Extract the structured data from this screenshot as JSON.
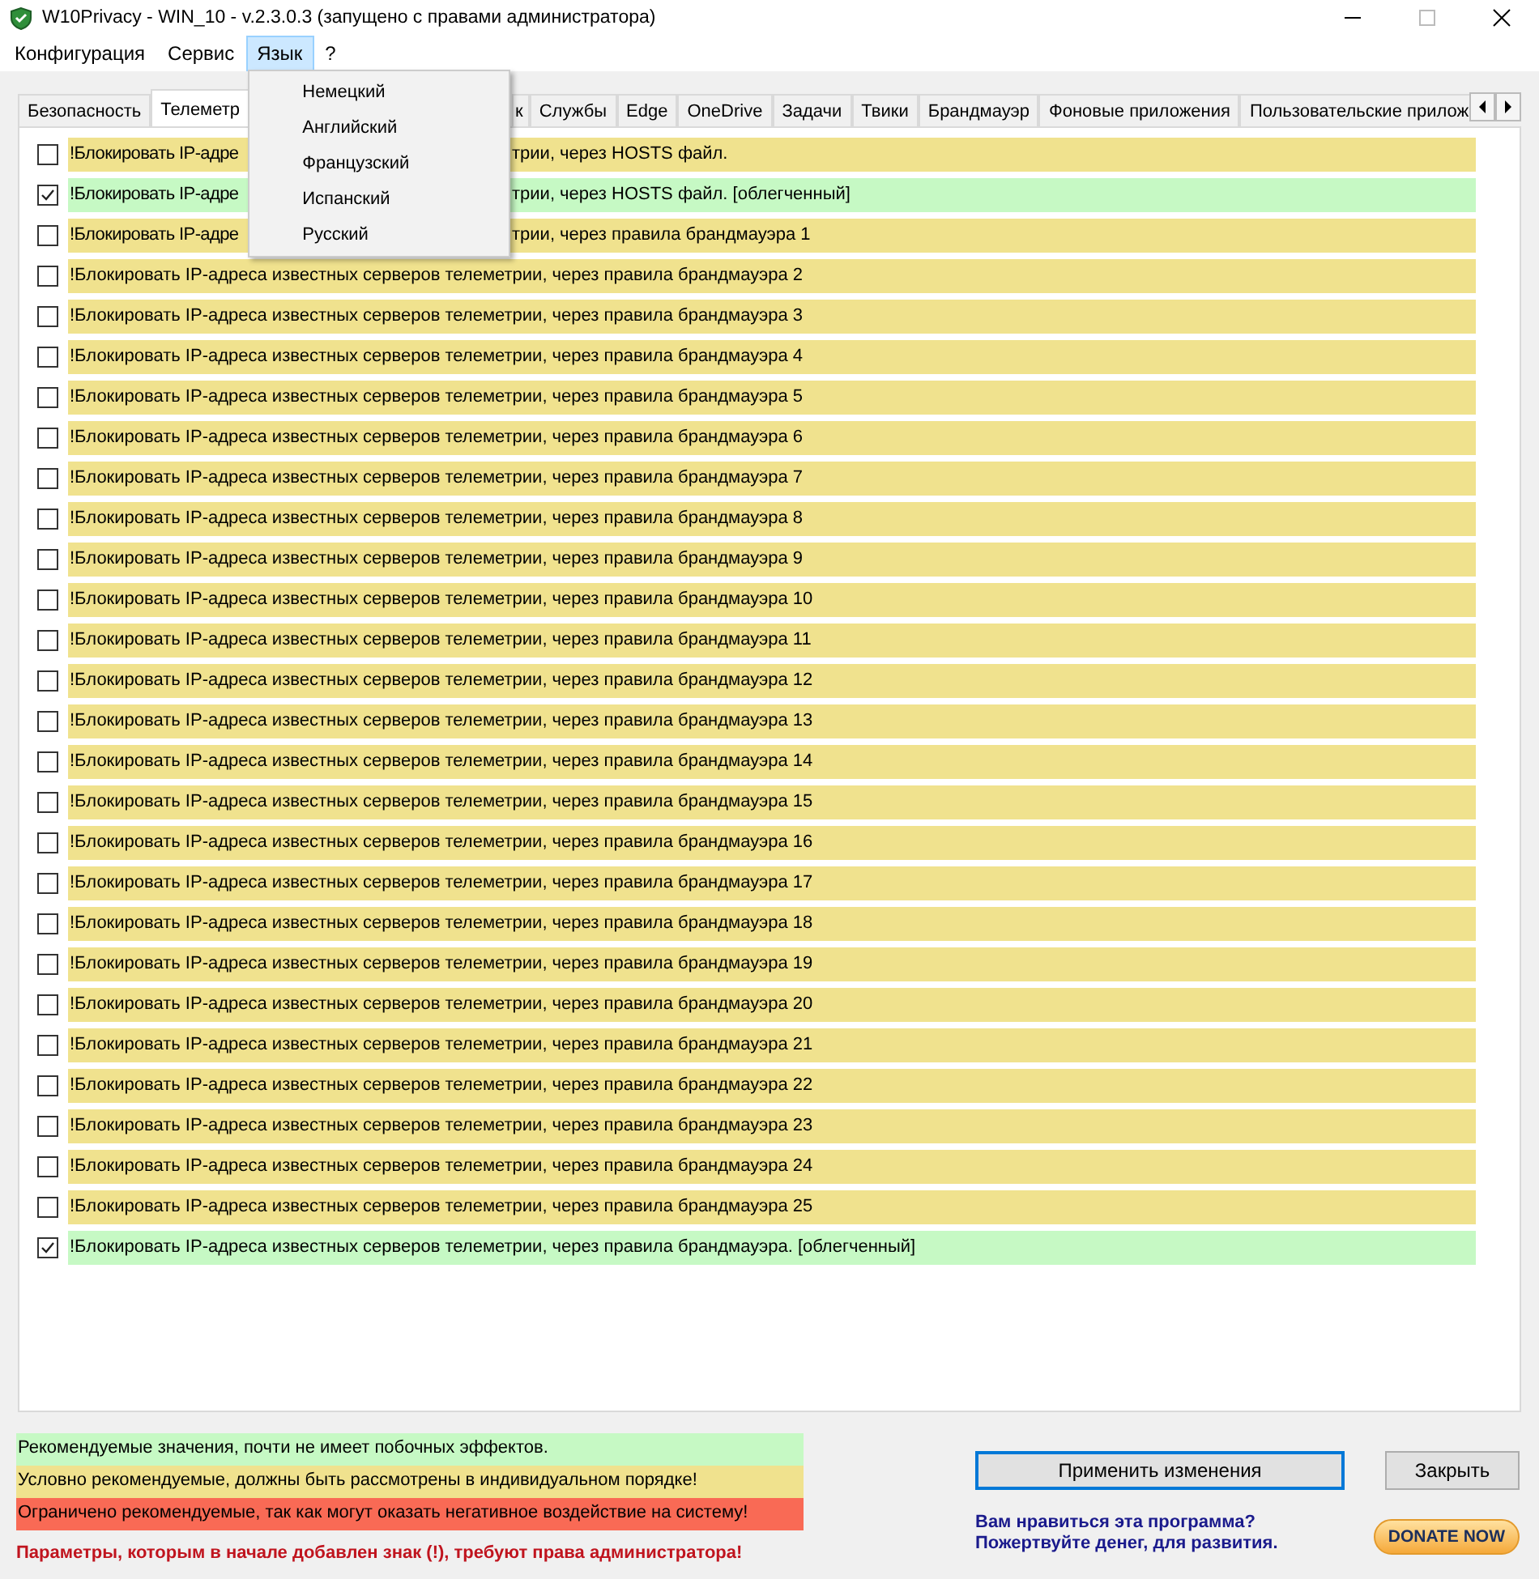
{
  "window": {
    "title": "W10Privacy - WIN_10 - v.2.3.0.3 (запущено с правами администратора)"
  },
  "menu_bar": [
    {
      "label": "Конфигурация",
      "selected": false
    },
    {
      "label": "Сервис",
      "selected": false
    },
    {
      "label": "Язык",
      "selected": true,
      "items": [
        "Немецкий",
        "Английский",
        "Французский",
        "Испанский",
        "Русский"
      ]
    },
    {
      "label": "?",
      "selected": false
    }
  ],
  "tabs": [
    {
      "label": "Безопасность",
      "selected": false
    },
    {
      "label": "Телеметр",
      "selected": true
    },
    {
      "label": "к",
      "selected": false
    },
    {
      "label": "Службы",
      "selected": false
    },
    {
      "label": "Edge",
      "selected": false
    },
    {
      "label": "OneDrive",
      "selected": false
    },
    {
      "label": "Задачи",
      "selected": false
    },
    {
      "label": "Твики",
      "selected": false
    },
    {
      "label": "Брандмауэр",
      "selected": false
    },
    {
      "label": "Фоновые приложения",
      "selected": false
    },
    {
      "label": "Пользовательские прилож",
      "selected": false
    }
  ],
  "settings": [
    {
      "label_parts": [
        "!Блокировать IP-адре",
        "трии, через HOSTS файл."
      ],
      "kind": "conditional",
      "checked": false
    },
    {
      "label_parts": [
        "!Блокировать IP-адре",
        "трии, через HOSTS файл. [облегченный]"
      ],
      "kind": "recommended",
      "checked": true
    },
    {
      "label_parts": [
        "!Блокировать IP-адре",
        "трии, через правила брандмауэра 1"
      ],
      "kind": "conditional",
      "checked": false
    },
    {
      "label": "!Блокировать IP-адреса известных серверов телеметрии, через правила брандмауэра 2",
      "kind": "conditional",
      "checked": false
    },
    {
      "label": "!Блокировать IP-адреса известных серверов телеметрии, через правила брандмауэра 3",
      "kind": "conditional",
      "checked": false
    },
    {
      "label": "!Блокировать IP-адреса известных серверов телеметрии, через правила брандмауэра 4",
      "kind": "conditional",
      "checked": false
    },
    {
      "label": "!Блокировать IP-адреса известных серверов телеметрии, через правила брандмауэра 5",
      "kind": "conditional",
      "checked": false
    },
    {
      "label": "!Блокировать IP-адреса известных серверов телеметрии, через правила брандмауэра 6",
      "kind": "conditional",
      "checked": false
    },
    {
      "label": "!Блокировать IP-адреса известных серверов телеметрии, через правила брандмауэра 7",
      "kind": "conditional",
      "checked": false
    },
    {
      "label": "!Блокировать IP-адреса известных серверов телеметрии, через правила брандмауэра 8",
      "kind": "conditional",
      "checked": false
    },
    {
      "label": "!Блокировать IP-адреса известных серверов телеметрии, через правила брандмауэра 9",
      "kind": "conditional",
      "checked": false
    },
    {
      "label": "!Блокировать IP-адреса известных серверов телеметрии, через правила брандмауэра 10",
      "kind": "conditional",
      "checked": false
    },
    {
      "label": "!Блокировать IP-адреса известных серверов телеметрии, через правила брандмауэра 11",
      "kind": "conditional",
      "checked": false
    },
    {
      "label": "!Блокировать IP-адреса известных серверов телеметрии, через правила брандмауэра 12",
      "kind": "conditional",
      "checked": false
    },
    {
      "label": "!Блокировать IP-адреса известных серверов телеметрии, через правила брандмауэра 13",
      "kind": "conditional",
      "checked": false
    },
    {
      "label": "!Блокировать IP-адреса известных серверов телеметрии, через правила брандмауэра 14",
      "kind": "conditional",
      "checked": false
    },
    {
      "label": "!Блокировать IP-адреса известных серверов телеметрии, через правила брандмауэра 15",
      "kind": "conditional",
      "checked": false
    },
    {
      "label": "!Блокировать IP-адреса известных серверов телеметрии, через правила брандмауэра 16",
      "kind": "conditional",
      "checked": false
    },
    {
      "label": "!Блокировать IP-адреса известных серверов телеметрии, через правила брандмауэра 17",
      "kind": "conditional",
      "checked": false
    },
    {
      "label": "!Блокировать IP-адреса известных серверов телеметрии, через правила брандмауэра 18",
      "kind": "conditional",
      "checked": false
    },
    {
      "label": "!Блокировать IP-адреса известных серверов телеметрии, через правила брандмауэра 19",
      "kind": "conditional",
      "checked": false
    },
    {
      "label": "!Блокировать IP-адреса известных серверов телеметрии, через правила брандмауэра 20",
      "kind": "conditional",
      "checked": false
    },
    {
      "label": "!Блокировать IP-адреса известных серверов телеметрии, через правила брандмауэра 21",
      "kind": "conditional",
      "checked": false
    },
    {
      "label": "!Блокировать IP-адреса известных серверов телеметрии, через правила брандмауэра 22",
      "kind": "conditional",
      "checked": false
    },
    {
      "label": "!Блокировать IP-адреса известных серверов телеметрии, через правила брандмауэра 23",
      "kind": "conditional",
      "checked": false
    },
    {
      "label": "!Блокировать IP-адреса известных серверов телеметрии, через правила брандмауэра 24",
      "kind": "conditional",
      "checked": false
    },
    {
      "label": "!Блокировать IP-адреса известных серверов телеметрии, через правила брандмауэра 25",
      "kind": "conditional",
      "checked": false
    },
    {
      "label": "!Блокировать IP-адреса известных серверов телеметрии, через правила брандмауэра.  [облегченный]",
      "kind": "recommended",
      "checked": true
    }
  ],
  "legend": [
    {
      "text": "Рекомендуемые значения, почти не имеет побочных эффектов.",
      "kind": "recommended"
    },
    {
      "text": "Условно рекомендуемые, должны быть рассмотрены в индивидуальном порядке!",
      "kind": "conditional"
    },
    {
      "text": "Ограничено рекомендуемые, так как могут оказать негативное воздействие на систему!",
      "kind": "limited"
    }
  ],
  "admin_note": "Параметры, которым в начале добавлен знак (!), требуют права администратора!",
  "buttons": [
    {
      "label": "Применить изменения",
      "selected": true
    },
    {
      "label": "Закрыть",
      "selected": false
    }
  ],
  "donate_text": [
    "Вам нравиться эта программа?",
    "Пожертвуйте денег, для развития."
  ],
  "donate_button": "DONATE NOW"
}
